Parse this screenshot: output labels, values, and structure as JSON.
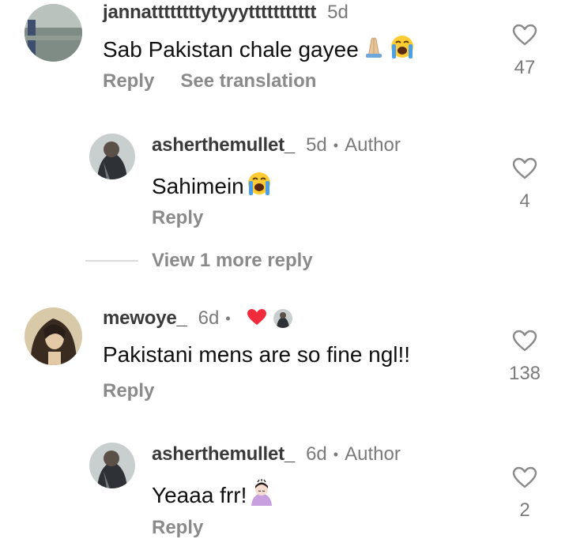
{
  "comments": [
    {
      "username": "jannattttttttytyyyttttttttttt",
      "time": "5d",
      "text": "Sab Pakistan chale gayee",
      "reply_label": "Reply",
      "translate_label": "See translation",
      "like_count": "47"
    },
    {
      "username": "asherthemullet_",
      "time": "5d",
      "author_label": "Author",
      "text": "Sahimein",
      "reply_label": "Reply",
      "like_count": "4"
    },
    {
      "username": "mewoye_",
      "time": "6d",
      "text": "Pakistani mens are so fine ngl!!",
      "reply_label": "Reply",
      "like_count": "138"
    },
    {
      "username": "asherthemullet_",
      "time": "6d",
      "author_label": "Author",
      "text": "Yeaaa frr!",
      "reply_label": "Reply",
      "like_count": "2"
    }
  ],
  "view_more_replies": "View 1 more reply",
  "icons": {
    "like": "heart-outline-icon",
    "creator_liked": "red-heart-icon",
    "emoji_1": "folded-hands-emoji",
    "emoji_2": "loudly-crying-face-emoji",
    "emoji_3": "woman-bowing-emoji"
  },
  "colors": {
    "liked_heart": "#ef2b3c",
    "secondary_text": "#7a7a7a"
  }
}
